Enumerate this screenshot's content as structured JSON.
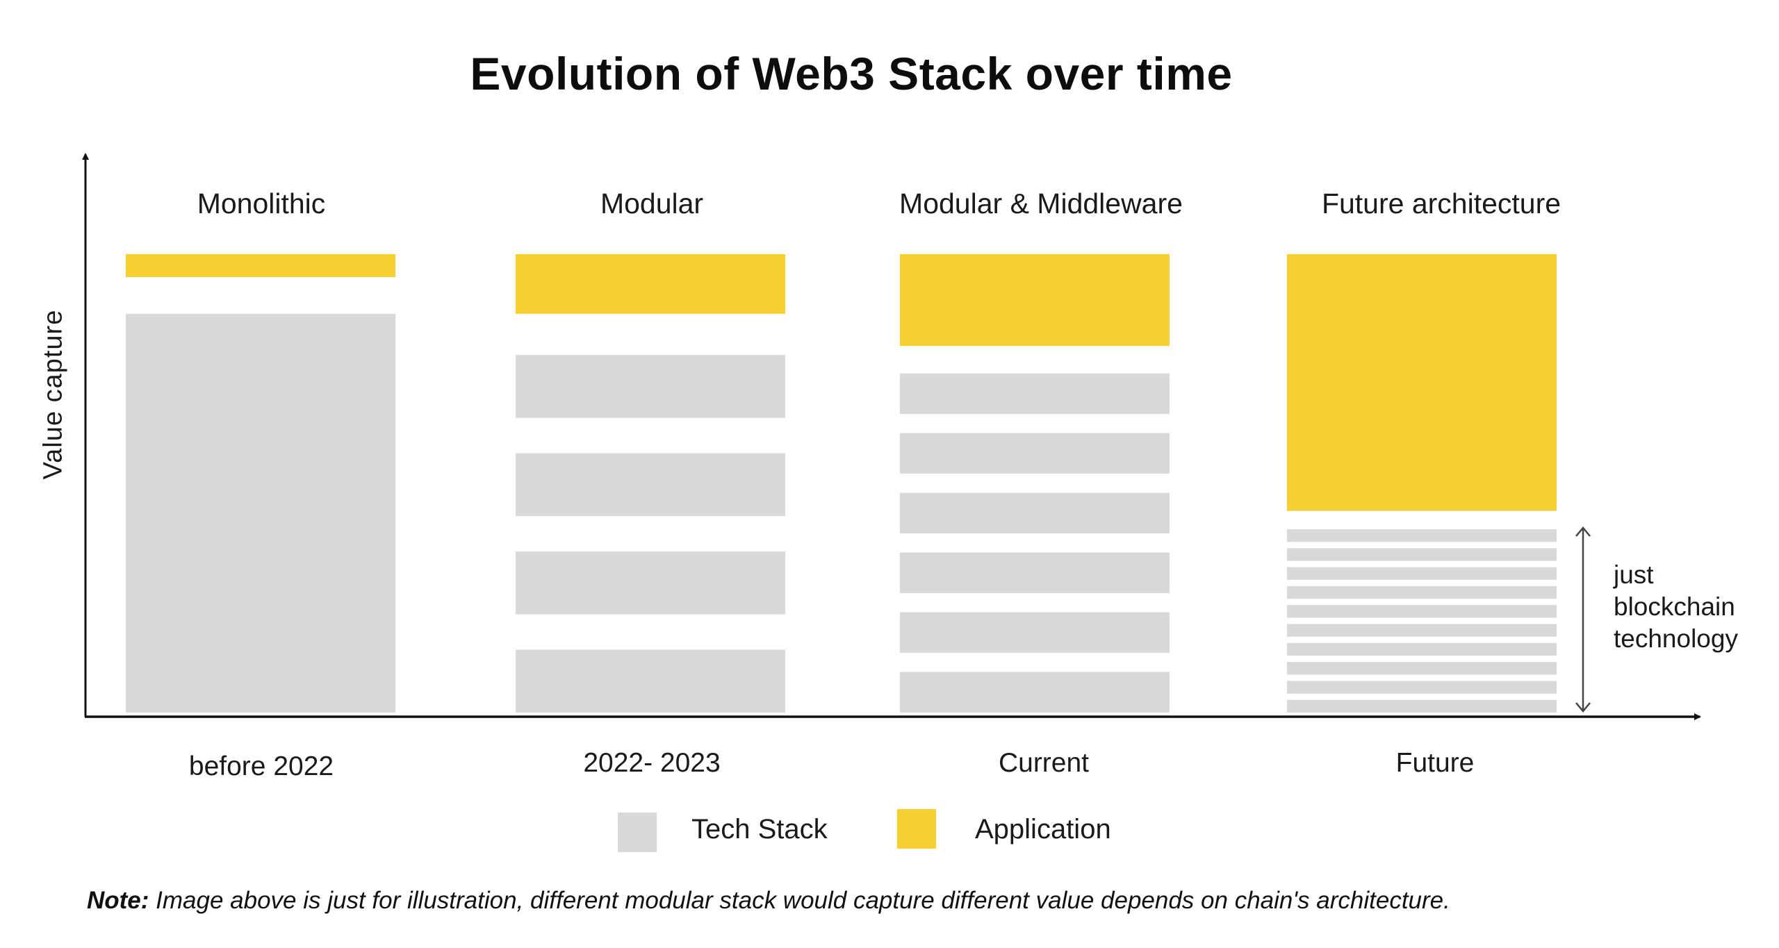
{
  "title": "Evolution of Web3 Stack over time",
  "colors": {
    "tech_stack": "#d9d9d9",
    "application": "#f6cf32",
    "axis": "#111111",
    "background": "#ffffff"
  },
  "chart_data": {
    "type": "bar",
    "title": "Evolution of Web3 Stack over time",
    "xlabel": "",
    "ylabel": "Value capture",
    "grid": false,
    "categories": [
      "before 2022",
      "2022- 2023",
      "Current",
      "Future"
    ],
    "column_headers": [
      "Monolithic",
      "Modular",
      "Modular & Middleware",
      "Future architecture"
    ],
    "series": [
      {
        "name": "Application",
        "color": "#f6cf32",
        "values": [
          0.05,
          0.13,
          0.2,
          0.56
        ]
      },
      {
        "name": "Tech Stack",
        "color": "#d9d9d9",
        "values": [
          0.87,
          0.78,
          0.74,
          0.4
        ],
        "layer_counts": [
          1,
          4,
          6,
          10
        ]
      }
    ],
    "legend": {
      "position": "bottom-center",
      "entries": [
        "Tech Stack",
        "Application"
      ]
    },
    "annotation": {
      "text_lines": [
        "just",
        "blockchain",
        "technology"
      ],
      "target": "Future Tech Stack layers",
      "marker": "double-headed-arrow"
    },
    "y_axis_ticks": false
  },
  "legend": {
    "items": [
      {
        "label": "Tech Stack",
        "color": "#d9d9d9"
      },
      {
        "label": "Application",
        "color": "#f6cf32"
      }
    ]
  },
  "note": {
    "bold": "Note:",
    "text": " Image above is just for illustration, different modular stack would capture different value depends on chain's architecture."
  }
}
